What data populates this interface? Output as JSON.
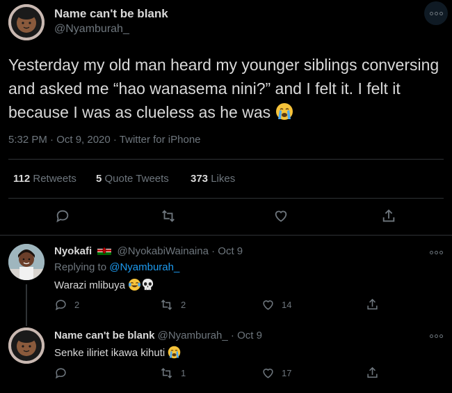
{
  "main_tweet": {
    "author_name": "Name can't be blank",
    "handle": "@Nyamburah_",
    "text": "Yesterday my old man heard my younger siblings conversing and asked me “hao wanasema nini?” and I felt it. I felt it because I was as clueless as he was",
    "text_emoji": "loudly-crying-face",
    "timestamp": "5:32 PM · Oct 9, 2020 · Twitter for iPhone",
    "stats": {
      "retweets_count": "112",
      "retweets_label": "Retweets",
      "quotes_count": "5",
      "quotes_label": "Quote Tweets",
      "likes_count": "373",
      "likes_label": "Likes"
    }
  },
  "replies": [
    {
      "author_name": "Nyokafi",
      "flag": "kenya-flag",
      "handle": "@NyokabiWainaina",
      "date": "· Oct 9",
      "replying_prefix": "Replying to",
      "replying_to": "@Nyamburah_",
      "text": "Warazi mlibuya",
      "emojis": [
        "face-with-tears-of-joy",
        "skull"
      ],
      "reply_count": "2",
      "retweet_count": "2",
      "like_count": "14"
    },
    {
      "author_name": "Name can't be blank",
      "handle": "@Nyamburah_",
      "date": "· Oct 9",
      "text": "Senke iliriet ikawa kihuti",
      "emojis": [
        "loudly-crying-face"
      ],
      "reply_count": "",
      "retweet_count": "1",
      "like_count": "17"
    }
  ],
  "colors": {
    "background": "#000000",
    "text": "#d9d9d9",
    "muted": "#6e767d",
    "link": "#1d9bf0",
    "divider": "#2f3336"
  }
}
